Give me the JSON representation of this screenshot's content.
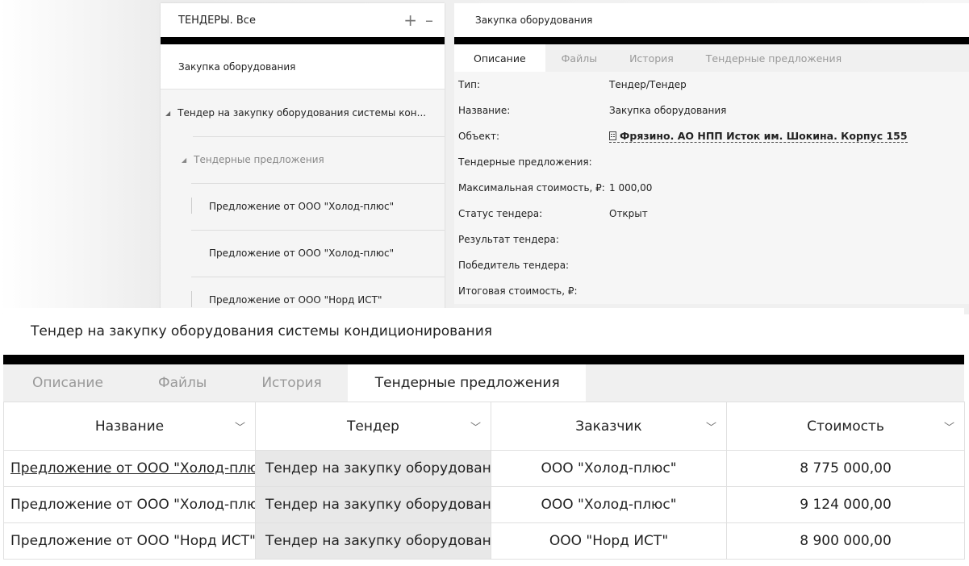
{
  "tree": {
    "title": "ТЕНДЕРЫ. Все",
    "add_icon": "+",
    "collapse_icon": "–",
    "selected": "Закупка оборудования",
    "nodes": [
      {
        "level": 1,
        "label": "Тендер на закупку оборудования системы кон..."
      },
      {
        "level": 2,
        "label": "Тендерные предложения"
      },
      {
        "level": 3,
        "label": "Предложение от ООО \"Холод-плюс\""
      },
      {
        "level": 3,
        "label": "Предложение от ООО \"Холод-плюс\""
      },
      {
        "level": 3,
        "label": "Предложение от ООО \"Норд ИСТ\""
      }
    ]
  },
  "detail": {
    "title": "Закупка оборудования",
    "tabs": [
      "Описание",
      "Файлы",
      "История",
      "Тендерные предложения"
    ],
    "active_tab": 0,
    "props": [
      {
        "label": "Тип:",
        "value": "Тендер/Тендер"
      },
      {
        "label": "Название:",
        "value": "Закупка оборудования"
      },
      {
        "label": "Объект:",
        "value": "Фрязино. АО НПП Исток им. Шокина. Корпус 155"
      },
      {
        "label": "Тендерные предложения:",
        "value": ""
      },
      {
        "label": "Максимальная стоимость, ₽:",
        "value": "1 000,00"
      },
      {
        "label": "Статус тендера:",
        "value": "Открыт"
      },
      {
        "label": "Результат тендера:",
        "value": ""
      },
      {
        "label": "Победитель тендера:",
        "value": ""
      },
      {
        "label": "Итоговая стоимость, ₽:",
        "value": ""
      }
    ]
  },
  "tender": {
    "title": "Тендер на закупку оборудования системы кондиционирования",
    "tabs": [
      "Описание",
      "Файлы",
      "История",
      "Тендерные предложения"
    ],
    "active_tab": 3,
    "columns": [
      "Название",
      "Тендер",
      "Заказчик",
      "Стоимость"
    ],
    "rows": [
      {
        "name": "Предложение от ООО \"Холод-плюс\"",
        "tender": "Тендер на закупку оборудования",
        "customer": "ООО \"Холод-плюс\"",
        "cost": "8 775 000,00"
      },
      {
        "name": "Предложение от ООО \"Холод-плюс\"",
        "tender": "Тендер на закупку оборудования",
        "customer": "ООО \"Холод-плюс\"",
        "cost": "9 124 000,00"
      },
      {
        "name": "Предложение от ООО \"Норд ИСТ\"",
        "tender": "Тендер на закупку оборудования",
        "customer": "ООО \"Норд ИСТ\"",
        "cost": "8 900 000,00"
      }
    ]
  }
}
